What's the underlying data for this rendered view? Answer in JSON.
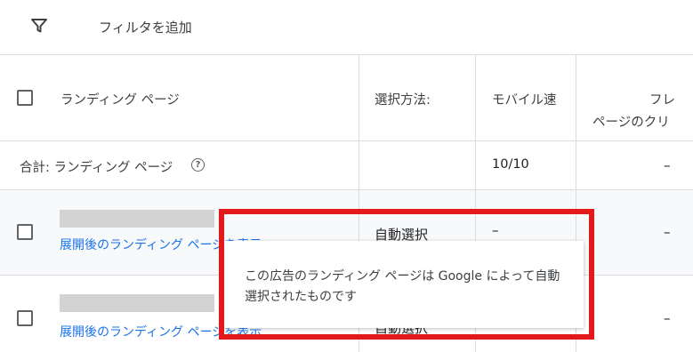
{
  "toolbar": {
    "filter_icon": "filter-funnel-icon",
    "add_filter_label": "フィルタを追加"
  },
  "table": {
    "columns": {
      "landing_page": "ランディング ページ",
      "selection_method": "選択方法:",
      "mobile_speed": "モバイル速",
      "freq_line1": "フレ",
      "freq_line2": "ページのクリ"
    },
    "total_row": {
      "label": "合計: ランディング ページ",
      "help_icon": "help-circle-icon",
      "help_glyph": "?",
      "selection_method": "",
      "mobile_speed": "10/10",
      "freq": "–"
    },
    "rows": [
      {
        "link": "展開後のランディング ページを表示",
        "selection_method": "自動選択",
        "mobile_speed": "–",
        "freq": "–"
      },
      {
        "link": "展開後のランディング ページを表示",
        "selection_method": "自動選択",
        "mobile_speed": "",
        "freq": "–"
      }
    ]
  },
  "tooltip": {
    "text": "この広告のランディング ページは Google によって自動選択されたものです"
  },
  "colors": {
    "highlight": "#e3191b",
    "link": "#1a73e8",
    "row_hover": "#f8f9fa"
  }
}
